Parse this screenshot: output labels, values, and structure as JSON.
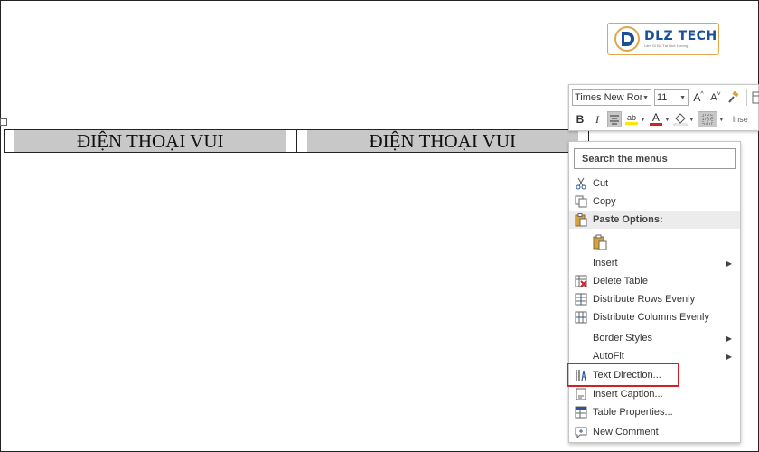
{
  "logo": {
    "name": "DLZ TECH",
    "tagline": "Làm Gì Đó Tại Quê Hương"
  },
  "table": {
    "cells": [
      "ĐIỆN THOẠI VUI",
      "ĐIỆN THOẠI VUI"
    ]
  },
  "toolbar": {
    "font_name": "Times New Rom",
    "font_size": "11",
    "grow_label": "A",
    "shrink_label": "A",
    "bold_label": "B",
    "italic_label": "I",
    "highlight_label": "ab",
    "font_color_label": "A",
    "insert_label": "Inse",
    "font_color": "#d32027",
    "highlight_color": "#ffe600"
  },
  "menu": {
    "search_placeholder": "Search the menus",
    "items": [
      {
        "label": "Cut",
        "icon": "scissors-icon"
      },
      {
        "label": "Copy",
        "icon": "copy-icon"
      },
      {
        "label": "Paste Options:",
        "icon": "paste-icon"
      },
      {
        "label": "",
        "icon": "paste-keep-icon"
      },
      {
        "label": "Insert",
        "icon": "",
        "submenu": true
      },
      {
        "label": "Delete Table",
        "icon": "delete-table-icon"
      },
      {
        "label": "Distribute Rows Evenly",
        "icon": "distribute-rows-icon"
      },
      {
        "label": "Distribute Columns Evenly",
        "icon": "distribute-columns-icon"
      },
      {
        "label": "Border Styles",
        "icon": "",
        "submenu": true
      },
      {
        "label": "AutoFit",
        "icon": "",
        "submenu": true
      },
      {
        "label": "Text Direction...",
        "icon": "text-direction-icon"
      },
      {
        "label": "Insert Caption...",
        "icon": "caption-icon"
      },
      {
        "label": "Table Properties...",
        "icon": "table-properties-icon"
      },
      {
        "label": "New Comment",
        "icon": "comment-icon"
      }
    ]
  },
  "colors": {
    "highlight_border": "#d32027",
    "brand": "#1b4f9c"
  }
}
